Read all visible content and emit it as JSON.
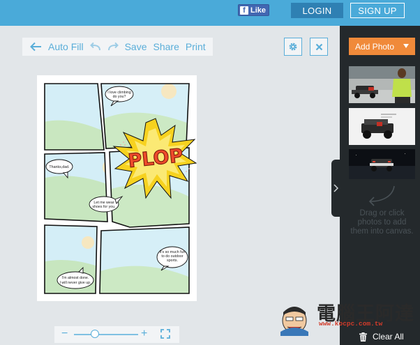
{
  "header": {
    "facebook_like": "Like",
    "login": "LOGIN",
    "signup": "SIGN UP"
  },
  "toolbar": {
    "auto_fill": "Auto Fill",
    "save": "Save",
    "share": "Share",
    "print": "Print"
  },
  "icons": {
    "back": "arrow-left-icon",
    "undo": "undo-icon",
    "redo": "redo-icon",
    "settings": "gear-icon",
    "close": "close-icon",
    "zoom_out": "minus-icon",
    "zoom_in": "plus-icon",
    "fullscreen": "fullscreen-icon",
    "trash": "trash-icon",
    "expand": "chevron-right-icon"
  },
  "comic": {
    "bubbles": [
      {
        "lines": [
          "I love climbing",
          "do you?"
        ]
      },
      {
        "lines": [
          "Thanks,dad."
        ]
      },
      {
        "lines": [
          "Let me wear",
          "shoes for you."
        ]
      },
      {
        "lines": [
          "It's so much fun",
          "to do outdoor",
          "sports."
        ]
      },
      {
        "lines": [
          "I'm almost done.",
          "I will never give up."
        ]
      }
    ],
    "sound_effect": "PLOP"
  },
  "zoom": {
    "level_fraction": 0.33
  },
  "panel": {
    "add_photo": "Add Photo",
    "drag_hint": [
      "Drag or click",
      "photos to add",
      "them into canvas."
    ],
    "clear_all": "Clear All"
  },
  "watermark": {
    "brand": "電腦王阿達",
    "url": "www.kocpc.com.tw"
  },
  "colors": {
    "topbar": "#4aaad9",
    "accent": "#5aaed9",
    "add_photo": "#f08a3a",
    "panel": "#24292c",
    "workspace": "#e2e6e9"
  }
}
